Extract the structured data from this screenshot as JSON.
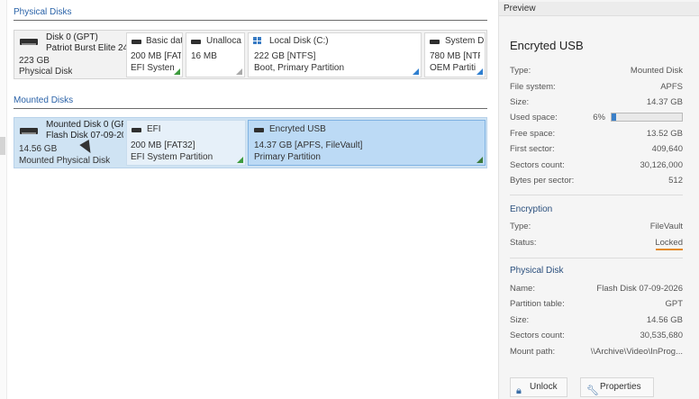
{
  "physical_section": {
    "title": "Physical Disks"
  },
  "physical_disk": {
    "name": "Disk 0 (GPT)",
    "model": "Patriot Burst Elite 24",
    "size": "223 GB",
    "type": "Physical Disk",
    "partitions": [
      {
        "name": "Basic dat",
        "detail": "200 MB [FAT3",
        "desc": "EFI System",
        "corner": "green"
      },
      {
        "name": "Unalloca",
        "detail": "16 MB",
        "desc": "",
        "corner": "gray"
      },
      {
        "name": "Local Disk (C:)",
        "detail": "222 GB [NTFS]",
        "desc": "Boot, Primary Partition",
        "corner": "blue",
        "icon": "windows-icon"
      },
      {
        "name": "System D",
        "detail": "780 MB [NTF",
        "desc": "OEM Partiti",
        "corner": "blue"
      }
    ]
  },
  "mounted_section": {
    "title": "Mounted Disks"
  },
  "mounted_disk": {
    "name": "Mounted Disk 0 (GP",
    "model": "Flash Disk 07-09-20",
    "size": "14.56 GB",
    "type": "Mounted Physical Disk",
    "partitions": [
      {
        "name": "EFI",
        "detail": "200 MB [FAT32]",
        "desc": "EFI System Partition",
        "corner": "green"
      },
      {
        "name": "Encryted USB",
        "detail": "14.37 GB [APFS, FileVault]",
        "desc": "Primary Partition",
        "corner": "dgreen",
        "selected": true
      }
    ]
  },
  "preview": {
    "header": "Preview",
    "title": "Encryted USB",
    "volume": [
      {
        "k": "Type:",
        "v": "Mounted Disk"
      },
      {
        "k": "File system:",
        "v": "APFS"
      },
      {
        "k": "Size:",
        "v": "14.37 GB"
      },
      {
        "k": "Used space:",
        "v": "6%"
      },
      {
        "k": "Free space:",
        "v": "13.52 GB"
      },
      {
        "k": "First sector:",
        "v": "409,640"
      },
      {
        "k": "Sectors count:",
        "v": "30,126,000"
      },
      {
        "k": "Bytes per sector:",
        "v": "512"
      }
    ],
    "used_fraction": 0.06,
    "encryption": {
      "heading": "Encryption",
      "rows": [
        {
          "k": "Type:",
          "v": "FileVault"
        },
        {
          "k": "Status:",
          "v": "Locked"
        }
      ]
    },
    "physical": {
      "heading": "Physical Disk",
      "rows": [
        {
          "k": "Name:",
          "v": "Flash Disk 07-09-2026"
        },
        {
          "k": "Partition table:",
          "v": "GPT"
        },
        {
          "k": "Size:",
          "v": "14.56 GB"
        },
        {
          "k": "Sectors count:",
          "v": "30,535,680"
        },
        {
          "k": "Mount path:",
          "v": "\\\\Archive\\Video\\InProg..."
        }
      ]
    },
    "buttons": {
      "unlock": "Unlock",
      "properties": "Properties"
    },
    "colors": {
      "usage_fill": "#3a7fc8",
      "locked_underline": "#e38a2b"
    }
  }
}
